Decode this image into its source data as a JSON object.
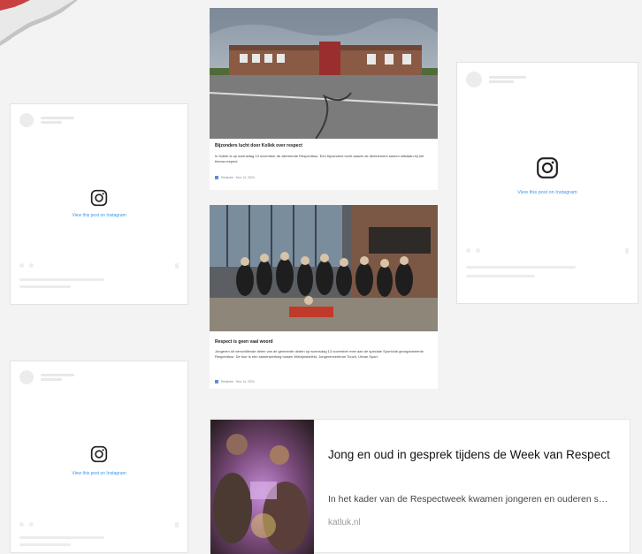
{
  "instagram": {
    "view_label": "View this post on Instagram"
  },
  "news": [
    {
      "title": "Bijzonders lucht door Kollek over respect",
      "desc": "In Kollek is op woensdag 13 november de allereerste Respecttour. Een bijzondere tocht waarin de deelnemers samen stilstaan bij het thema respect.",
      "meta": "Redactie · Nov 14, 2024"
    },
    {
      "title": "Respect is geen vaal woord",
      "desc": "Jongeren uit verschillende delen van de gemeente deden op woensdag 13 november mee aan de speciale Sportclub georganiseerde Respecttour. De tour is een samenwerking tussen Welzijnsbeleid, Jongerencentrum Touch, Urban Sport.",
      "meta": "Redactie · Nov 14, 2024"
    }
  ],
  "link_card": {
    "title": "Jong en oud in gesprek tijdens de Week van Respect",
    "description": "In het kader van de Respectweek kwamen jongeren en ouderen samen",
    "domain": "katluk.nl"
  }
}
